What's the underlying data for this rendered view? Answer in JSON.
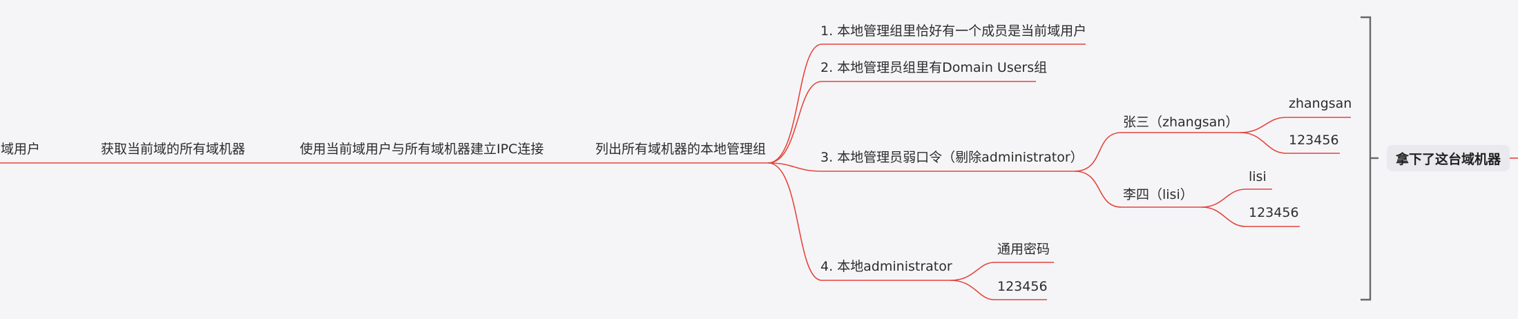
{
  "theme": {
    "line_color": "#e4453a",
    "bracket_color": "#666666",
    "text_color": "#2b2b2b"
  },
  "chain": {
    "node1": "是域用户",
    "node2": "获取当前域的所有域机器",
    "node3": "使用当前域用户与所有域机器建立IPC连接",
    "node4": "列出所有域机器的本地管理组"
  },
  "branches": {
    "b1": "1. 本地管理组里恰好有一个成员是当前域用户",
    "b2": "2. 本地管理员组里有Domain Users组",
    "b3": {
      "label": "3. 本地管理员弱口令（剔除administrator）",
      "zhangsan": {
        "label": "张三（zhangsan）",
        "user": "zhangsan",
        "pass": "123456"
      },
      "lisi": {
        "label": "李四（lisi）",
        "user": "lisi",
        "pass": "123456"
      }
    },
    "b4": {
      "label": "4. 本地administrator",
      "common": "通用密码",
      "pass": "123456"
    }
  },
  "summary": "拿下了这台域机器"
}
